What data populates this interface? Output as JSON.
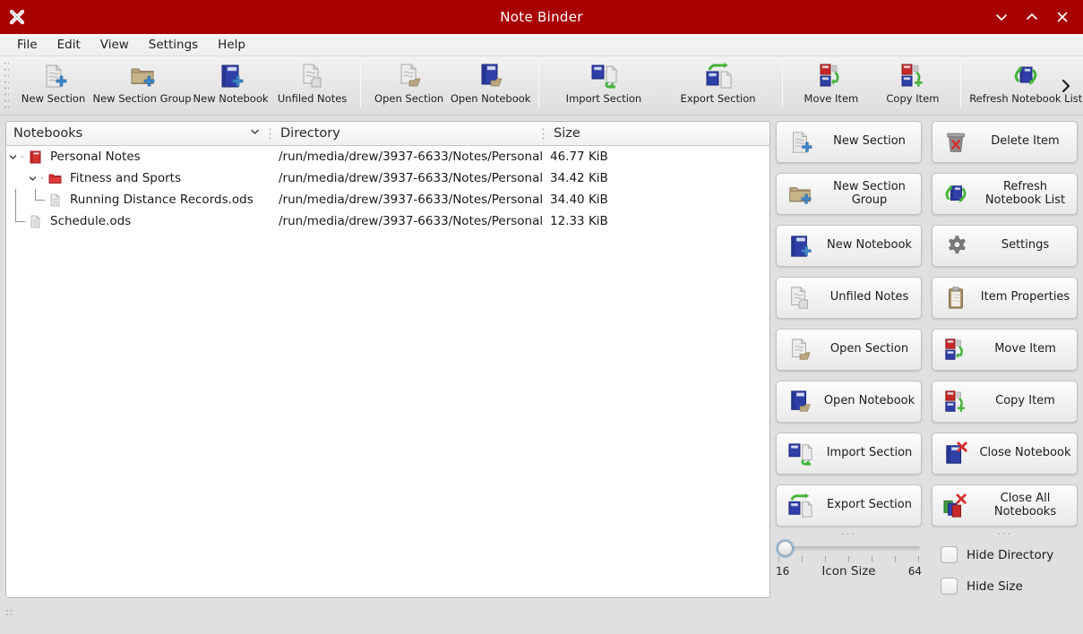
{
  "window": {
    "title": "Note Binder",
    "app_icon": "close-x-icon",
    "accent_color": "#a80000",
    "controls": [
      {
        "name": "minimize-button",
        "icon": "chevron-down-icon"
      },
      {
        "name": "maximize-button",
        "icon": "chevron-up-icon"
      },
      {
        "name": "close-button",
        "icon": "close-x-icon"
      }
    ]
  },
  "menubar": {
    "items": [
      {
        "label": "File"
      },
      {
        "label": "Edit"
      },
      {
        "label": "View"
      },
      {
        "label": "Settings"
      },
      {
        "label": "Help"
      }
    ]
  },
  "toolbar": {
    "overflow_icon": "chevron-right-icon",
    "groups": [
      {
        "items": [
          {
            "label": "New Section",
            "icon": "document-add-icon"
          },
          {
            "label": "New Section Group",
            "icon": "folder-add-icon"
          },
          {
            "label": "New Notebook",
            "icon": "notebook-add-icon"
          },
          {
            "label": "Unfiled Notes",
            "icon": "documents-icon"
          }
        ]
      },
      {
        "items": [
          {
            "label": "Open Section",
            "icon": "document-open-icon"
          },
          {
            "label": "Open Notebook",
            "icon": "notebook-open-icon"
          }
        ]
      },
      {
        "items": [
          {
            "label": "Import Section",
            "icon": "import-icon"
          },
          {
            "label": "Export Section",
            "icon": "export-icon"
          }
        ]
      },
      {
        "items": [
          {
            "label": "Move Item",
            "icon": "move-item-icon"
          },
          {
            "label": "Copy Item",
            "icon": "copy-item-icon"
          }
        ]
      },
      {
        "items": [
          {
            "label": "Refresh Notebook List",
            "icon": "refresh-notebook-icon"
          }
        ]
      }
    ]
  },
  "tree": {
    "columns": [
      {
        "label": "Notebooks",
        "sort_icon": "chevron-down-icon"
      },
      {
        "label": "Directory"
      },
      {
        "label": "Size"
      }
    ],
    "rows": [
      {
        "label": "Personal Notes",
        "directory": "/run/media/drew/3937-6633/Notes/Personal ...",
        "size": "46.77 KiB",
        "icon": "notebook-red-icon",
        "depth": 0,
        "expanded": true
      },
      {
        "label": "Fitness and Sports",
        "directory": "/run/media/drew/3937-6633/Notes/Personal ...",
        "size": "34.42 KiB",
        "icon": "folder-red-icon",
        "depth": 1,
        "expanded": true
      },
      {
        "label": "Running Distance Records.ods",
        "directory": "/run/media/drew/3937-6633/Notes/Personal ...",
        "size": "34.40 KiB",
        "icon": "document-icon",
        "depth": 2,
        "expanded": false
      },
      {
        "label": "Schedule.ods",
        "directory": "/run/media/drew/3937-6633/Notes/Personal ...",
        "size": "12.33 KiB",
        "icon": "document-icon",
        "depth": 1,
        "expanded": false
      }
    ]
  },
  "panel": {
    "buttons": [
      {
        "label": "New Section",
        "icon": "document-add-icon"
      },
      {
        "label": "Delete Item",
        "icon": "trash-icon"
      },
      {
        "label": "New Section Group",
        "icon": "folder-add-icon"
      },
      {
        "label": "Refresh Notebook List",
        "icon": "refresh-notebook-icon"
      },
      {
        "label": "New Notebook",
        "icon": "notebook-add-icon"
      },
      {
        "label": "Settings",
        "icon": "gear-icon"
      },
      {
        "label": "Unfiled Notes",
        "icon": "documents-icon"
      },
      {
        "label": "Item Properties",
        "icon": "clipboard-icon"
      },
      {
        "label": "Open Section",
        "icon": "document-open-icon"
      },
      {
        "label": "Move Item",
        "icon": "move-item-icon"
      },
      {
        "label": "Open Notebook",
        "icon": "notebook-open-icon"
      },
      {
        "label": "Copy Item",
        "icon": "copy-item-icon"
      },
      {
        "label": "Import Section",
        "icon": "import-icon"
      },
      {
        "label": "Close Notebook",
        "icon": "notebook-close-icon"
      },
      {
        "label": "Export Section",
        "icon": "export-icon"
      },
      {
        "label": "Close All Notebooks",
        "icon": "notebooks-close-all-icon"
      }
    ],
    "overflow_left": "...",
    "overflow_right": "...",
    "slider": {
      "label": "Icon Size",
      "min": "16",
      "max": "64",
      "value": "16"
    },
    "checkboxes": [
      {
        "label": "Hide Directory",
        "checked": false
      },
      {
        "label": "Hide Size",
        "checked": false
      }
    ]
  }
}
